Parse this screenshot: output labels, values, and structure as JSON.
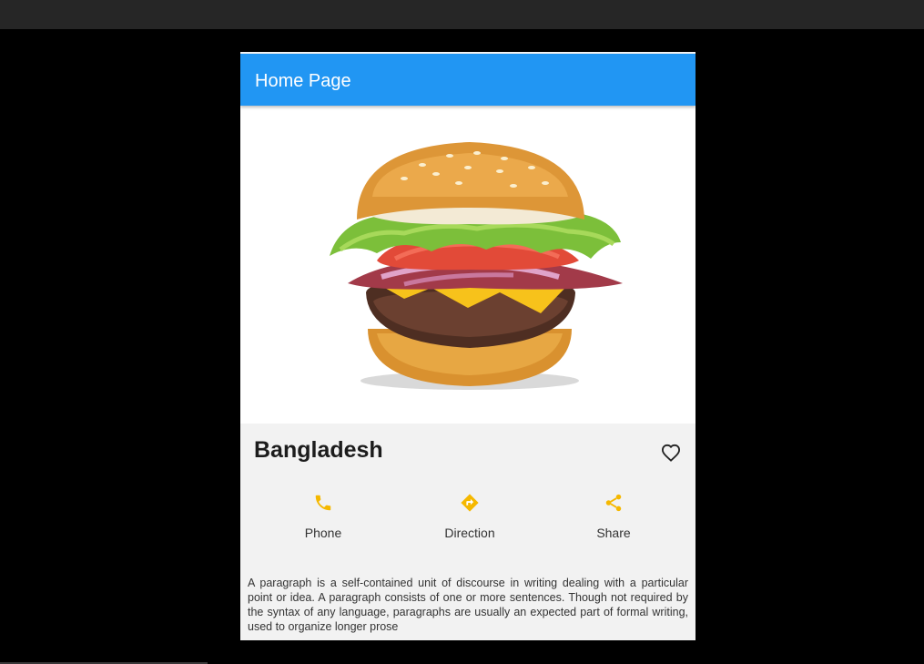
{
  "app": {
    "title": "Home Page",
    "accent_color": "#2196f3",
    "action_color": "#f5b800"
  },
  "hero": {
    "image": "burger-photo"
  },
  "place": {
    "title": "Bangladesh",
    "favorite_icon": "heart-outline-icon"
  },
  "actions": [
    {
      "label": "Phone",
      "icon": "phone-icon"
    },
    {
      "label": "Direction",
      "icon": "directions-icon"
    },
    {
      "label": "Share",
      "icon": "share-icon"
    }
  ],
  "description": "A paragraph is a self-contained unit of discourse in writing dealing with a particular point or idea. A paragraph consists of one or more sentences. Though not required by the syntax of any language, paragraphs are usually an expected part of formal writing, used to organize longer prose"
}
